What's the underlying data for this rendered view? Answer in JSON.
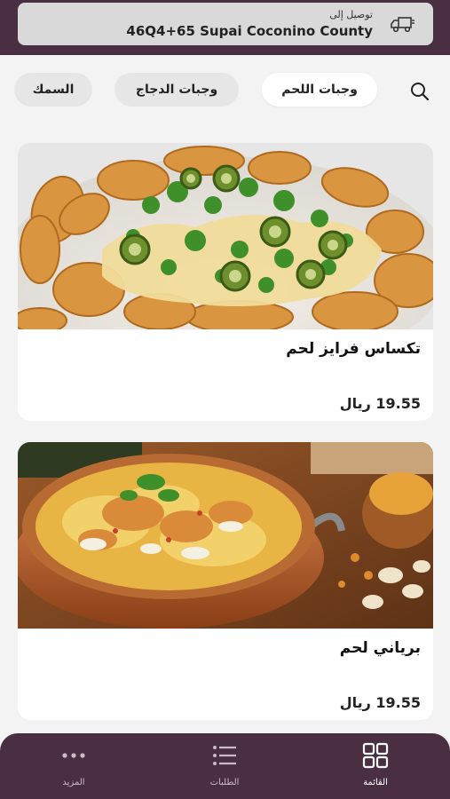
{
  "header": {
    "delivery_label": "توصيل إلى",
    "address": "46Q4+65 Supai Coconino County",
    "truck_icon": "delivery-truck-icon"
  },
  "categories": {
    "search_icon": "search-icon",
    "items": [
      {
        "label": "وجبات اللحم",
        "active": true
      },
      {
        "label": "وجبات الدجاج",
        "active": false
      },
      {
        "label": "السمك",
        "active": false
      }
    ]
  },
  "products": [
    {
      "name": "تكساس فرايز لحم",
      "price": "19.55 ريال"
    },
    {
      "name": "برياني لحم",
      "price": "19.55 ريال"
    }
  ],
  "bottom_nav": {
    "items": [
      {
        "label": "القائمة",
        "icon": "grid-icon",
        "active": true
      },
      {
        "label": "الطلبات",
        "icon": "list-icon",
        "active": false
      },
      {
        "label": "المزيد",
        "icon": "more-dots-icon",
        "active": false
      }
    ]
  },
  "colors": {
    "brand": "#4a2f43",
    "background": "#f3f3f3"
  }
}
